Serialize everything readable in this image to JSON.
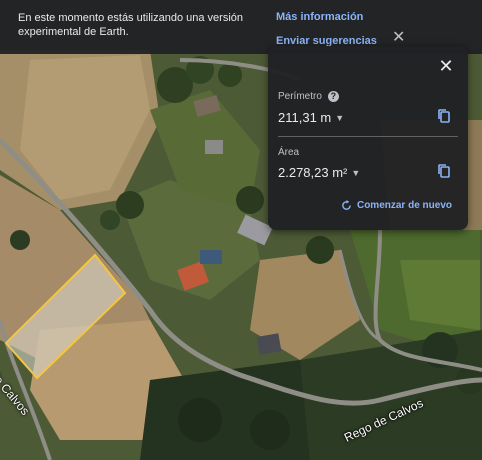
{
  "banner": {
    "message": "En este momento estás utilizando una versión experimental de Earth.",
    "more_info": "Más información",
    "send_feedback": "Enviar sugerencias"
  },
  "measure": {
    "perimeter_label": "Perímetro",
    "perimeter_value": "211,31 m",
    "area_label": "Área",
    "area_value": "2.278,23 m²",
    "restart_label": "Comenzar de nuevo"
  },
  "map": {
    "road_label_left": "de Calvos",
    "road_label_bottom": "Rego de Calvos"
  },
  "colors": {
    "accent": "#8ab4f8",
    "polygon_outline": "#f4c542"
  }
}
